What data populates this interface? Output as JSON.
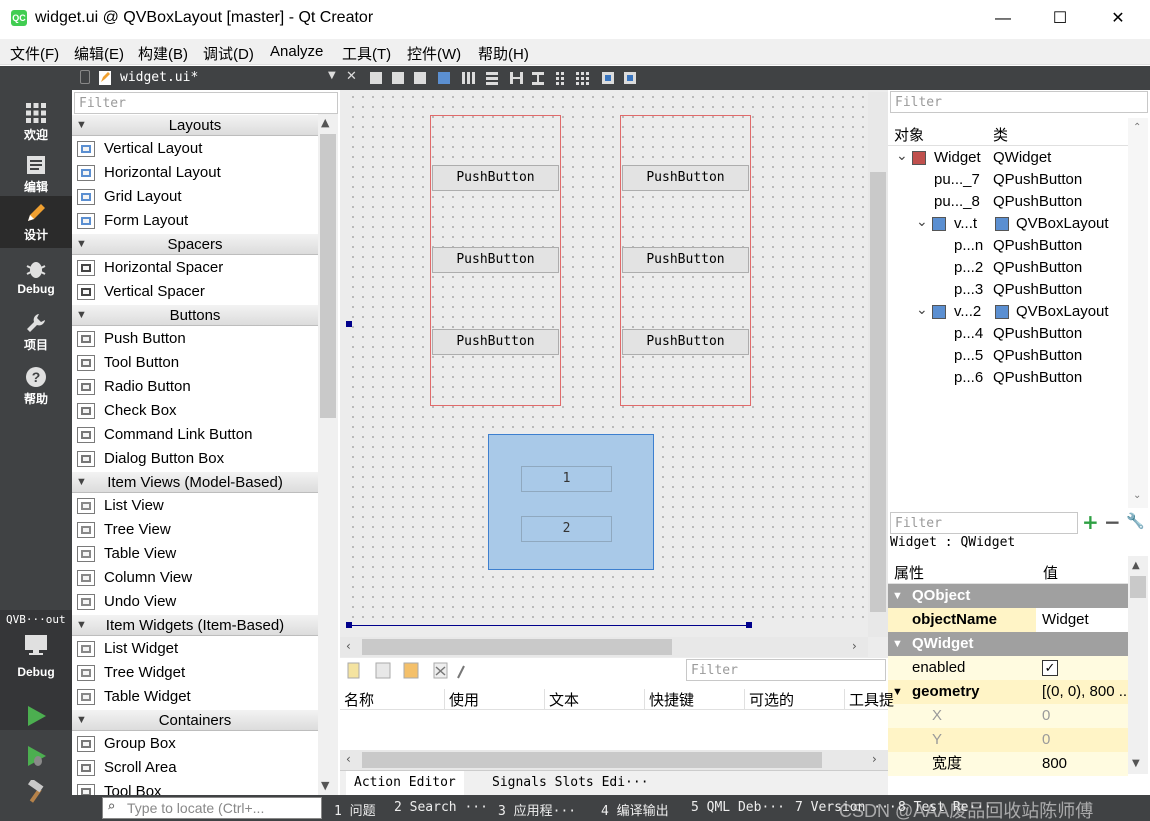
{
  "window": {
    "title": "widget.ui @ QVBoxLayout [master] - Qt Creator",
    "app_icon_text": "QC",
    "minimize": "—",
    "maximize": "☐",
    "close": "✕"
  },
  "menu": [
    "文件(F)",
    "编辑(E)",
    "构建(B)",
    "调试(D)",
    "Analyze",
    "工具(T)",
    "控件(W)",
    "帮助(H)"
  ],
  "modes": [
    {
      "label": "欢迎",
      "icon": "grid-icon"
    },
    {
      "label": "编辑",
      "icon": "edit-document-icon"
    },
    {
      "label": "设计",
      "icon": "pencil-icon"
    },
    {
      "label": "Debug",
      "icon": "bug-icon"
    },
    {
      "label": "项目",
      "icon": "wrench-icon"
    },
    {
      "label": "帮助",
      "icon": "help-icon"
    }
  ],
  "kit": {
    "project": "QVB···out",
    "mode": "Debug"
  },
  "document": {
    "name": "widget.ui*"
  },
  "widgetbox": {
    "filter_placeholder": "Filter",
    "categories": [
      {
        "name": "Layouts",
        "items": [
          "Vertical Layout",
          "Horizontal Layout",
          "Grid Layout",
          "Form Layout"
        ]
      },
      {
        "name": "Spacers",
        "items": [
          "Horizontal Spacer",
          "Vertical Spacer"
        ]
      },
      {
        "name": "Buttons",
        "items": [
          "Push Button",
          "Tool Button",
          "Radio Button",
          "Check Box",
          "Command Link Button",
          "Dialog Button Box"
        ]
      },
      {
        "name": "Item Views (Model-Based)",
        "items": [
          "List View",
          "Tree View",
          "Table View",
          "Column View",
          "Undo View"
        ]
      },
      {
        "name": "Item Widgets (Item-Based)",
        "items": [
          "List Widget",
          "Tree Widget",
          "Table Widget"
        ]
      },
      {
        "name": "Containers",
        "items": [
          "Group Box",
          "Scroll Area",
          "Tool Box"
        ]
      }
    ]
  },
  "form": {
    "left_buttons": [
      "PushButton",
      "PushButton",
      "PushButton"
    ],
    "right_buttons": [
      "PushButton",
      "PushButton",
      "PushButton"
    ],
    "selected_items": [
      "1",
      "2"
    ]
  },
  "object_inspector": {
    "filter_placeholder": "Filter",
    "headers": [
      "对象",
      "类"
    ],
    "rows": [
      {
        "obj": "Widget",
        "cls": "QWidget"
      },
      {
        "obj": "pu..._7",
        "cls": "QPushButton"
      },
      {
        "obj": "pu..._8",
        "cls": "QPushButton"
      },
      {
        "obj": "v...t",
        "cls": "QVBoxLayout"
      },
      {
        "obj": "p...n",
        "cls": "QPushButton"
      },
      {
        "obj": "p...2",
        "cls": "QPushButton"
      },
      {
        "obj": "p...3",
        "cls": "QPushButton"
      },
      {
        "obj": "v...2",
        "cls": "QVBoxLayout"
      },
      {
        "obj": "p...4",
        "cls": "QPushButton"
      },
      {
        "obj": "p...5",
        "cls": "QPushButton"
      },
      {
        "obj": "p...6",
        "cls": "QPushButton"
      }
    ]
  },
  "property_editor": {
    "filter_placeholder": "Filter",
    "context": "Widget : QWidget",
    "headers": [
      "属性",
      "值"
    ],
    "group_qobject": "QObject",
    "objectName_label": "objectName",
    "objectName_value": "Widget",
    "group_qwidget": "QWidget",
    "enabled_label": "enabled",
    "enabled_value": true,
    "geometry_label": "geometry",
    "geometry_value": "[(0, 0), 800 ...",
    "x_label": "X",
    "x_value": "0",
    "y_label": "Y",
    "y_value": "0",
    "width_label": "宽度",
    "width_value": "800"
  },
  "action_editor": {
    "filter_placeholder": "Filter",
    "columns": [
      "名称",
      "使用",
      "文本",
      "快捷键",
      "可选的",
      "工具提"
    ],
    "tabs": [
      "Action Editor",
      "Signals  Slots Edi···"
    ]
  },
  "statusbar": {
    "locate_placeholder": "Type to locate (Ctrl+...",
    "panes": [
      "1 问题",
      "2 Search ···",
      "3 应用程···",
      "4 编译输出",
      "5 QML Deb···",
      "7 Version ···",
      "8 Test Re···"
    ]
  },
  "watermark": "CSDN @AAA废品回收站陈师傅",
  "colors": {
    "modebar": "#404244",
    "selection": "#a9c9e8",
    "layout_border": "#e06a6a",
    "property_group": "#a0a0a0",
    "property_yellow": "#fff4c6"
  }
}
